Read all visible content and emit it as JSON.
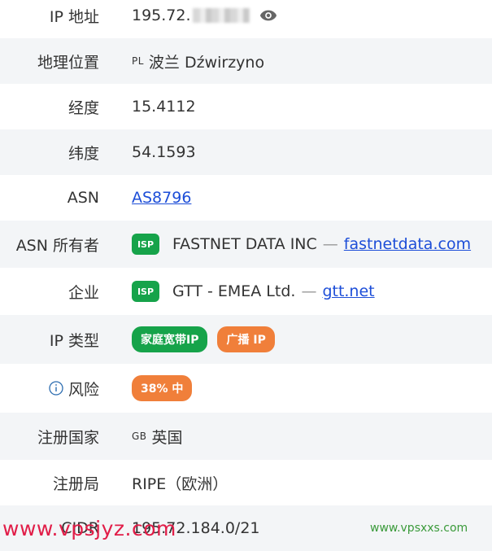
{
  "rows": [
    {
      "label": "IP 地址",
      "value": "195.72."
    },
    {
      "label": "地理位置",
      "country_code": "PL",
      "value": "波兰 Dźwirzyno"
    },
    {
      "label": "经度",
      "value": "15.4112"
    },
    {
      "label": "纬度",
      "value": "54.1593"
    },
    {
      "label": "ASN",
      "value": "AS8796"
    },
    {
      "label": "ASN 所有者",
      "badge": "ISP",
      "name": "FASTNET DATA INC",
      "separator": "—",
      "domain": "fastnetdata.com"
    },
    {
      "label": "企业",
      "badge": "ISP",
      "name": "GTT - EMEA Ltd.",
      "separator": "—",
      "domain": "gtt.net"
    },
    {
      "label": "IP 类型",
      "tags": [
        "家庭宽带IP",
        "广播 IP"
      ]
    },
    {
      "label": "风险",
      "risk": "38% 中"
    },
    {
      "label": "注册国家",
      "country_code": "GB",
      "value": "英国"
    },
    {
      "label": "注册局",
      "value": "RIPE（欧洲）"
    },
    {
      "label": "CIDR",
      "value": "195.72.184.0/21"
    }
  ],
  "icons": {
    "ip_reveal": "eye-icon",
    "risk_info": "info-circle-icon"
  },
  "colors": {
    "accent_green": "#16a34a",
    "accent_orange": "#f07f3a",
    "link": "#1d4ed8",
    "row_alt": "#f3f5f7"
  },
  "watermarks": {
    "left": "www.vpsjyz.com",
    "right": "www.vpsxxs.com"
  }
}
